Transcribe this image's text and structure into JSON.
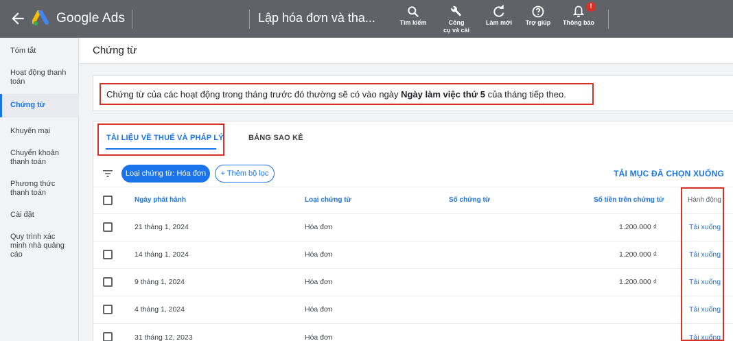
{
  "topbar": {
    "brand": "Google Ads",
    "page_title": "Lập hóa đơn và tha...",
    "tools": [
      {
        "icon": "search-icon",
        "label1": "Tìm kiếm",
        "label2": ""
      },
      {
        "icon": "wrench-icon",
        "label1": "Công",
        "label2": "cụ và cài"
      },
      {
        "icon": "refresh-icon",
        "label1": "Làm mới",
        "label2": ""
      },
      {
        "icon": "help-icon",
        "label1": "Trợ giúp",
        "label2": ""
      },
      {
        "icon": "bell-icon",
        "label1": "Thông báo",
        "label2": ""
      }
    ],
    "notification_badge": "!"
  },
  "sidebar": {
    "items": [
      {
        "label": "Tóm tắt",
        "active": false
      },
      {
        "label": "Hoạt động thanh toán",
        "active": false
      },
      {
        "label": "Chứng từ",
        "active": true
      },
      {
        "label": "Khuyến mại",
        "active": false
      },
      {
        "label": "Chuyển khoản thanh toán",
        "active": false
      },
      {
        "label": "Phương thức thanh toán",
        "active": false
      },
      {
        "label": "Cài đặt",
        "active": false
      },
      {
        "label": "Quy trình xác minh nhà quảng cáo",
        "active": false
      }
    ]
  },
  "main": {
    "title": "Chứng từ",
    "notice": {
      "before": "Chứng từ của các hoạt động trong tháng trước đó thường sẽ có vào ngày ",
      "bold": "Ngày làm việc thứ 5",
      "after": " của tháng tiếp theo."
    },
    "tabs": [
      {
        "label": "TÀI LIỆU VỀ THUẾ VÀ PHÁP LÝ",
        "active": true
      },
      {
        "label": "BẢNG SAO KÊ",
        "active": false
      }
    ],
    "filters": {
      "active_chip": "Loại chứng từ: Hóa đơn",
      "add_filter": "+ Thêm bộ lọc",
      "download_selected": "TẢI MỤC ĐÃ CHỌN XUỐNG"
    },
    "table": {
      "columns": [
        "Ngày phát hành",
        "Loại chứng từ",
        "Số chứng từ",
        "Số tiền trên chứng từ",
        "Hành động"
      ],
      "rows": [
        {
          "date": "21 tháng 1, 2024",
          "type": "Hóa đơn",
          "number": "",
          "amount": "1.200.000 ₫",
          "action": "Tải xuống"
        },
        {
          "date": "14 tháng 1, 2024",
          "type": "Hóa đơn",
          "number": "",
          "amount": "1.200.000 ₫",
          "action": "Tải xuống"
        },
        {
          "date": "9 tháng 1, 2024",
          "type": "Hóa đơn",
          "number": "",
          "amount": "1.200.000 ₫",
          "action": "Tải xuống"
        },
        {
          "date": "4 tháng 1, 2024",
          "type": "Hóa đơn",
          "number": "",
          "amount": "",
          "action": "Tải xuống"
        },
        {
          "date": "31 tháng 12, 2023",
          "type": "Hóa đơn",
          "number": "",
          "amount": "",
          "action": "Tải xuống"
        }
      ]
    }
  },
  "colors": {
    "topbar": "#5f6368",
    "accent": "#1a73e8",
    "highlight_border": "#d93025"
  }
}
